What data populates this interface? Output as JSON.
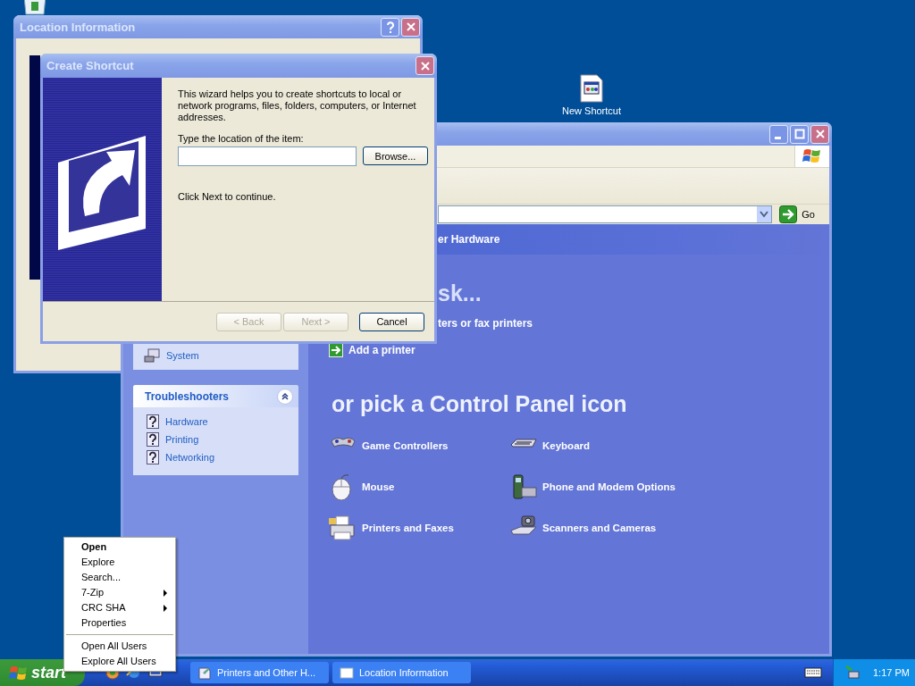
{
  "desktop_icons": [
    {
      "label": "New Shortcut"
    }
  ],
  "control_panel": {
    "address_go": "Go",
    "header": "er Hardware",
    "task_heading": "sk...",
    "tasks": [
      {
        "label": "ters or fax printers",
        "kind": "cut"
      },
      {
        "label": "Add a printer",
        "kind": "task"
      }
    ],
    "icons_heading": "or pick a Control Panel icon",
    "icons": [
      {
        "label": "Game Controllers",
        "kind": "gamepad"
      },
      {
        "label": "Keyboard",
        "kind": "keyboard"
      },
      {
        "label": "Mouse",
        "kind": "mouse"
      },
      {
        "label": "Phone and Modem Options",
        "kind": "phone"
      },
      {
        "label": "Printers and Faxes",
        "kind": "printer"
      },
      {
        "label": "Scanners and Cameras",
        "kind": "scanner"
      }
    ],
    "see_also": [
      {
        "label": "System"
      }
    ],
    "troubleshooters": {
      "title": "Troubleshooters",
      "expanded": true,
      "items": [
        {
          "label": "Hardware"
        },
        {
          "label": "Printing"
        },
        {
          "label": "Networking"
        }
      ]
    }
  },
  "location_window": {
    "title": "Location Information"
  },
  "wizard": {
    "title": "Create Shortcut",
    "intro": "This wizard helps you to create shortcuts to local or network programs, files, folders, computers, or Internet addresses.",
    "field_label": "Type the location of the item:",
    "browse": "Browse...",
    "hint": "Click Next to continue.",
    "buttons": [
      {
        "label": "< Back",
        "disabled": true
      },
      {
        "label": "Next >",
        "disabled": true
      },
      {
        "label": "Cancel",
        "disabled": false
      }
    ]
  },
  "context_menu": {
    "items": [
      {
        "label": "Open",
        "kind": "default"
      },
      {
        "label": "Explore",
        "kind": "item"
      },
      {
        "label": "Search...",
        "kind": "item"
      },
      {
        "label": "7-Zip",
        "kind": "submenu"
      },
      {
        "label": "CRC SHA",
        "kind": "submenu"
      },
      {
        "label": "Properties",
        "kind": "item"
      },
      {
        "kind": "separator"
      },
      {
        "label": "Open All Users",
        "kind": "item"
      },
      {
        "label": "Explore All Users",
        "kind": "item"
      }
    ]
  },
  "taskbar": {
    "start": "start",
    "tasks": [
      {
        "label": "Printers and Other H...",
        "kind": "folder",
        "selected": false
      },
      {
        "label": "Location Information",
        "kind": "window",
        "selected": false
      }
    ],
    "clock": "1:17 PM"
  }
}
